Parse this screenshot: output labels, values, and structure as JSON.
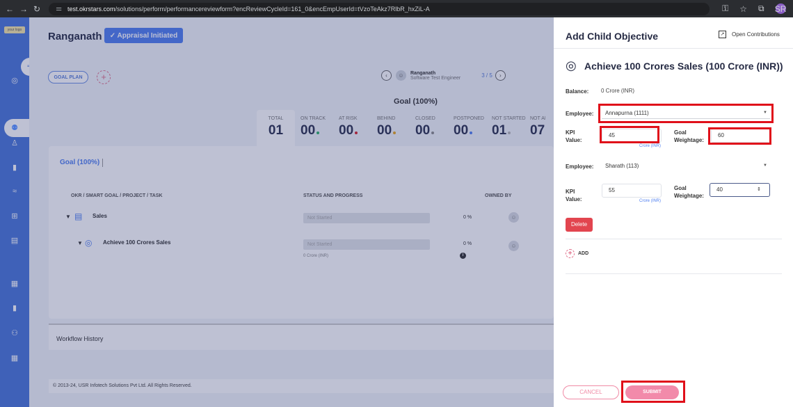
{
  "browser": {
    "url_prefix": "test.okrstars.com",
    "url_rest": "/solutions/perform/performancereviewform?encReviewCycleId=161_0&encEmpUserId=tVzoTeAkz7RlbR_hxZiL-A",
    "profile_initials": "SR",
    "nav_back": "←",
    "nav_forward": "→",
    "nav_reload": "↻",
    "site_info": "⚌",
    "key": "⚿",
    "star": "☆",
    "ext": "⧉",
    "menu": "⋮"
  },
  "sidebar": {
    "logo": "your logo",
    "toggle": "⇒"
  },
  "main": {
    "title": "Ranganath",
    "status_label": "✓ Appraisal Initiated",
    "goal_plan": "GOAL PLAN",
    "employee_name": "Ranganath",
    "employee_role": "Software Test Engineer",
    "pager": "3 / 5",
    "goal_head": "Goal (100%)",
    "stats": [
      {
        "label": "TOTAL",
        "value": "01",
        "dot": ""
      },
      {
        "label": "ON TRACK",
        "value": "00",
        "dot": "#2db36b"
      },
      {
        "label": "AT RISK",
        "value": "00",
        "dot": "#d9222a"
      },
      {
        "label": "BEHIND",
        "value": "00",
        "dot": "#e8a51c"
      },
      {
        "label": "CLOSED",
        "value": "00",
        "dot": "#8c8c8c"
      },
      {
        "label": "POSTPONED",
        "value": "00",
        "dot": "#4f7ff0"
      },
      {
        "label": "NOT STARTED",
        "value": "01",
        "dot": "#b8b8b8"
      },
      {
        "label": "NOT API",
        "value": "07",
        "dot": ""
      }
    ],
    "tab_goal": "Goal (100%)",
    "columns": [
      "OKR / SMART GOAL / PROJECT / TASK",
      "STATUS AND PROGRESS",
      "OWNED BY"
    ],
    "rows": [
      {
        "name": "Sales",
        "status": "Not Started",
        "pct": "0 %",
        "sub": ""
      },
      {
        "name": "Achieve 100 Crores Sales",
        "status": "Not Started",
        "pct": "0 %",
        "sub": "0 Crore (INR)"
      }
    ],
    "workflow": "Workflow History",
    "footer": "© 2013-24, USR Infotech Solutions Pvt Ltd. All Rights Reserved."
  },
  "drawer": {
    "title": "Add Child Objective",
    "open_contributions": "Open Contributions",
    "objective_title": "Achieve 100 Crores Sales (100 Crore (INR))",
    "balance_label": "Balance:",
    "balance_value": "0 Crore (INR)",
    "employee_label": "Employee:",
    "kpi_label": "KPI Value:",
    "weight_label": "Goal Weightage:",
    "unit": "Crore (INR)",
    "entries": [
      {
        "employee": "Annapurna (1111)",
        "kpi": "45",
        "weight": "60"
      },
      {
        "employee": "Sharath (113)",
        "kpi": "55",
        "weight": "40"
      }
    ],
    "delete": "Delete",
    "add": "ADD",
    "cancel": "CANCEL",
    "submit": "SUBMIT"
  }
}
